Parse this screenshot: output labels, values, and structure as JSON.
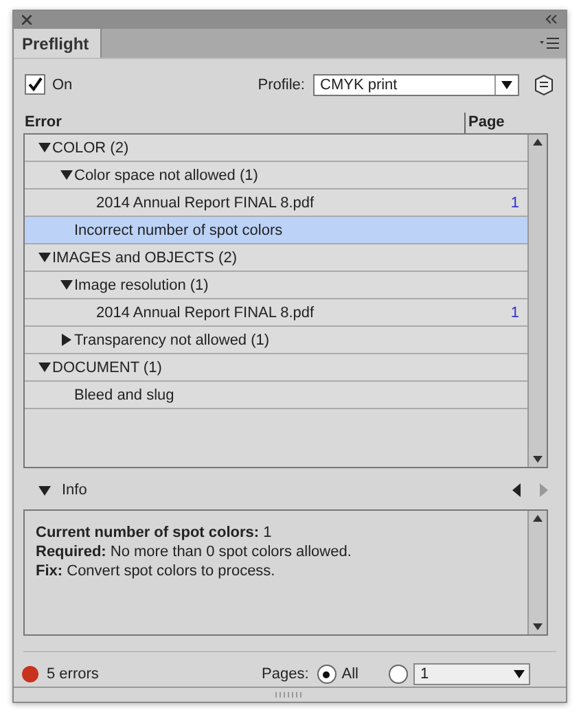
{
  "panel": {
    "tab": {
      "label": "Preflight",
      "selected": true
    }
  },
  "controls": {
    "on": {
      "label": "On",
      "checked": true
    },
    "profile": {
      "label": "Profile:",
      "value": "CMYK print"
    }
  },
  "table": {
    "columns": [
      "Error",
      "Page"
    ],
    "rows": [
      {
        "label": "COLOR (2)",
        "expanded": true,
        "selected": false,
        "children": [
          {
            "label": "Color space not allowed (1)",
            "expanded": true,
            "selected": false,
            "children": [
              {
                "label": "2014 Annual Report FINAL 8.pdf",
                "page": "1",
                "selected": false
              }
            ]
          },
          {
            "label": "Incorrect number of spot colors",
            "selected": true
          }
        ]
      },
      {
        "label": "IMAGES and OBJECTS (2)",
        "expanded": true,
        "selected": false,
        "children": [
          {
            "label": "Image resolution (1)",
            "expanded": true,
            "selected": false,
            "children": [
              {
                "label": "2014 Annual Report FINAL 8.pdf",
                "page": "1",
                "selected": false
              }
            ]
          },
          {
            "label": "Transparency not allowed (1)",
            "expanded": false,
            "selected": false
          }
        ]
      },
      {
        "label": "DOCUMENT (1)",
        "expanded": true,
        "selected": false,
        "children": [
          {
            "label": "Bleed and slug",
            "selected": false
          }
        ]
      }
    ]
  },
  "info": {
    "label": "Info",
    "expanded": true,
    "lines": [
      "**Current number of spot colors:** 1",
      "**Required:** No more than 0 spot colors allowed.",
      "**Fix:** Convert spot colors to process."
    ]
  },
  "footer": {
    "status": {
      "text": "5 errors",
      "color": "#c8321e"
    },
    "pages_label": "Pages:",
    "options": [
      {
        "label": "All",
        "selected": true
      },
      {
        "kind": "field",
        "value": "1",
        "selected": false
      }
    ]
  }
}
